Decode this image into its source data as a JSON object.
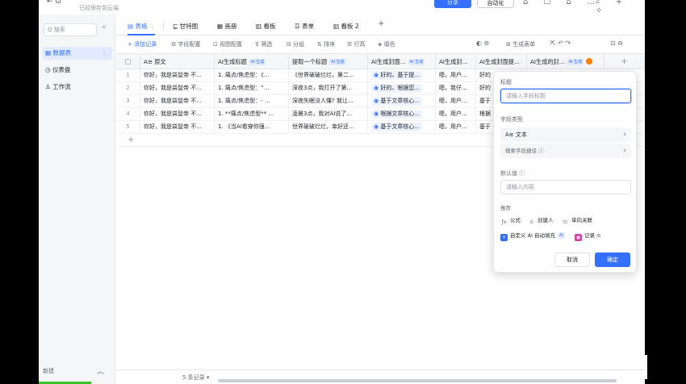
{
  "topbar": {
    "saved_text": "已经保存到云端",
    "share_label": "分享",
    "auto_label": "自动化",
    "left_icons": "⇤ ω",
    "icons_a": "⌂ ☐ ⌂ …",
    "icons_b": "⌕ + ✧"
  },
  "sidebar": {
    "search_placeholder": "Q 搜索",
    "collapse": "«",
    "items": [
      {
        "icon": "▦",
        "label": "数据表",
        "active": true,
        "more": "⋮"
      },
      {
        "icon": "◷",
        "label": "仪表盘"
      },
      {
        "icon": "♙",
        "label": "工作流"
      }
    ],
    "footer_label": "新建",
    "footer_caret": "︿"
  },
  "tabs": [
    {
      "label": "▤ 表格",
      "more": "⋮",
      "active": true
    },
    {
      "label": "⊑ 甘特图"
    },
    {
      "label": "▦ 画册"
    },
    {
      "label": "▥ 看板"
    },
    {
      "label": "☲ 表单"
    },
    {
      "label": "▥ 看板 2"
    },
    {
      "label": "+"
    }
  ],
  "toolbar": {
    "add_record": "+ 添加记录",
    "field_config": "⚙ 字段配置",
    "view_config": "⊡ 视图配置",
    "filter": "⊽ 筛选",
    "group": "⊟ 分组",
    "sort": "⇅ 排序",
    "row_height": "☰ 行高",
    "fill_color": "◈ 填色",
    "generate_form": "⊞ 生成表单",
    "right_icons_a": "◐ ⊚",
    "right_icons_b": "⇱ ↶ ↷",
    "right_icons_c": "⊡ ⊖"
  },
  "table": {
    "headers": [
      {
        "label": "A≡ 原文"
      },
      {
        "label": "AI生成标题",
        "ai": "AI 生成"
      },
      {
        "label": "提取一个标题",
        "ai": "AI 生成"
      },
      {
        "label": "AI生成封面...",
        "ai": "AI 生成"
      },
      {
        "label": "AI生成封..."
      },
      {
        "label": "AI生成封面提..."
      },
      {
        "label": "AI生成的封...",
        "ai": "AI 生成"
      }
    ],
    "add_col": "+",
    "rows": [
      {
        "n": "1",
        "c1": "你好，我是袋鼠帝 不...",
        "c2": "1. 痛点/焦虑型：《...",
        "c3": "《世界破破烂烂，第二...",
        "c4": "好的，基于提...",
        "c5": "嗯，用户...",
        "c6": "好的"
      },
      {
        "n": "2",
        "c1": "你好，我是袋鼠帝 不...",
        "c2": "1. 痛点/焦虑型：“...",
        "c3": "深夜3点，我打开了第...",
        "c4": "好的，根据您...",
        "c5": "嗯，我仔...",
        "c6": "好的"
      },
      {
        "n": "3",
        "c1": "你好，我是袋鼠帝 不...",
        "c2": "1. 痛点/焦虑型：- ...",
        "c3": "深夜失眠没人懂? 我让...",
        "c4": "基于文章核心...",
        "c5": "嗯，用户...",
        "c6": "基于"
      },
      {
        "n": "4",
        "c1": "你好，我是袋鼠帝 不...",
        "c2": "1. **痛点/焦虑型** ...",
        "c3": "凌晨3点，我对AI说了...",
        "c4": "根据文章核心...",
        "c5": "嗯，用户...",
        "c6": "根据"
      },
      {
        "n": "5",
        "c1": "你好，我是袋鼠帝 不...",
        "c2": "1. 《当AI看穿你强...",
        "c3": "世界破破烂烂，幸好还...",
        "c4": "基于文章核心...",
        "c5": "嗯，用户...",
        "c6": "基于"
      }
    ],
    "add_row": "+"
  },
  "bottom": {
    "record_count": "5 条记录 ▾"
  },
  "panel": {
    "title_label": "标题",
    "title_placeholder": "请输入字段标题",
    "type_label": "字段类型",
    "type_value": "A≡ 文本",
    "type_search": "搜索字段捷径 ⓘ",
    "type_arrow": "›",
    "default_label": "默认值 ⓘ",
    "default_placeholder": "请输入内容",
    "rec_label": "推荐",
    "recs": [
      {
        "icon": "ƒx",
        "label": "公式"
      },
      {
        "icon": "♙",
        "label": "创建人"
      },
      {
        "icon": "⊡",
        "label": "单向关联"
      },
      {
        "icon": "+",
        "label": "自定义 AI 自动填充",
        "tag": "AI"
      },
      {
        "icon": "◉",
        "label": "记录 ⊙"
      }
    ],
    "cancel": "取消",
    "confirm": "确定"
  },
  "colors": {
    "accent": "#3370ff",
    "ai_badge": "#e1eaff",
    "warn_dot": "#ff7d00"
  }
}
